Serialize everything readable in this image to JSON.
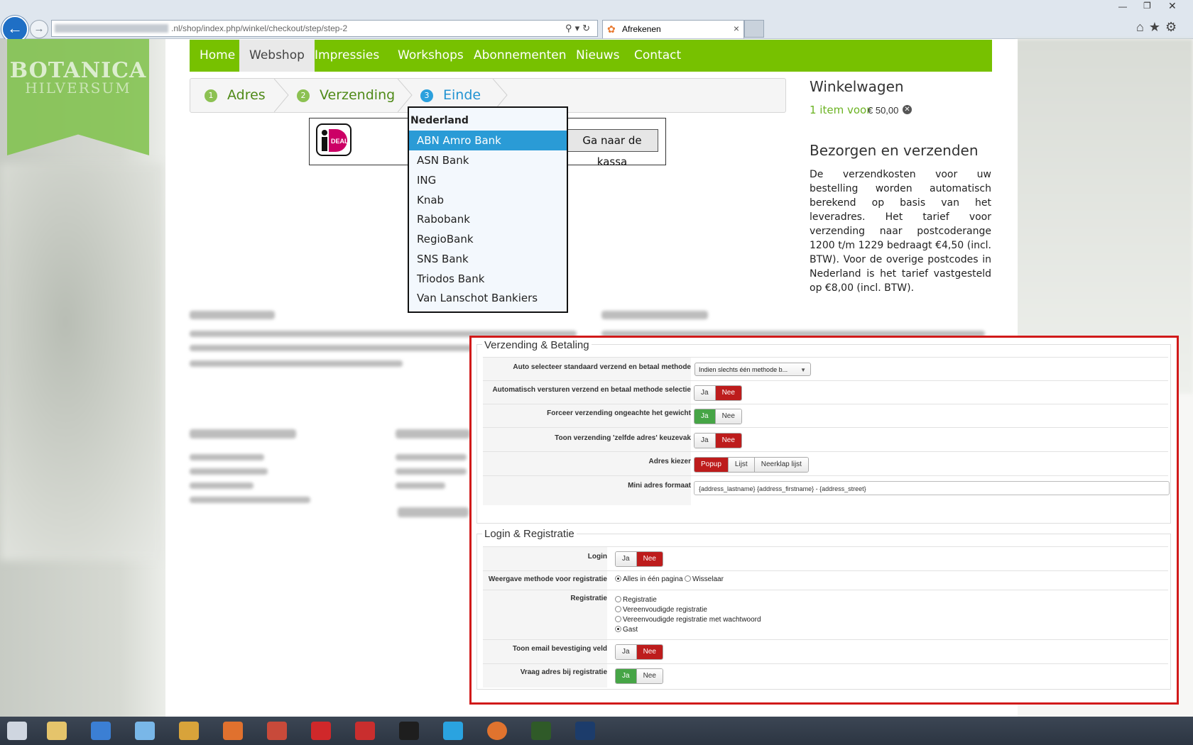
{
  "browser": {
    "url_suffix": ".nl/shop/index.php/winkel/checkout/step/step-2",
    "tab_title": "Afrekenen",
    "tab_close": "×"
  },
  "site": {
    "logo_title": "BOTANICA",
    "logo_subtitle": "HILVERSUM",
    "nav": [
      "Home",
      "Webshop",
      "Impressies",
      "Workshops",
      "Abonnementen",
      "Nieuws",
      "Contact"
    ],
    "nav_active": "Webshop"
  },
  "checkout_steps": [
    {
      "number": "1",
      "label": "Adres"
    },
    {
      "number": "2",
      "label": "Verzending"
    },
    {
      "number": "3",
      "label": "Einde"
    }
  ],
  "payment": {
    "ideal_logo_text": "DEAL",
    "bank_group": "Nederland",
    "banks": [
      "ABN Amro Bank",
      "ASN Bank",
      "ING",
      "Knab",
      "Rabobank",
      "RegioBank",
      "SNS Bank",
      "Triodos Bank",
      "Van Lanschot Bankiers"
    ],
    "selected_bank": "ABN Amro Bank",
    "checkout_button": "Ga naar de kassa"
  },
  "sidebar": {
    "cart_title": "Winkelwagen",
    "cart_items": "1 item voor",
    "cart_price": "€ 50,00",
    "shipping_title": "Bezorgen en verzenden",
    "shipping_text": "De verzendkosten voor uw bestelling worden automatisch berekend op basis van het leveradres. Het tarief voor verzending naar postcoderange 1200 t/m 1229 bedraagt €4,50 (incl. BTW). Voor de overige postcodes in Nederland is het tarief vastgesteld op €8,00 (incl. BTW)."
  },
  "admin": {
    "section1_title": "Verzending & Betaling",
    "rows1": [
      {
        "label": "Auto selecteer standaard verzend en betaal methode",
        "select": "Indien slechts één methode b..."
      },
      {
        "label": "Automatisch versturen verzend en betaal methode selectie",
        "on": "Ja",
        "off": "Nee",
        "value": "Nee"
      },
      {
        "label": "Forceer verzending ongeachte het gewicht",
        "on": "Ja",
        "off": "Nee",
        "value": "Ja"
      },
      {
        "label": "Toon verzending 'zelfde adres' keuzevak",
        "on": "Ja",
        "off": "Nee",
        "value": "Nee"
      },
      {
        "label": "Adres kiezer",
        "options": [
          "Popup",
          "Lijst",
          "Neerklap lijst"
        ],
        "value": "Popup"
      },
      {
        "label": "Mini adres formaat",
        "input": "{address_lastname} {address_firstname} - {address_street}"
      }
    ],
    "section2_title": "Login & Registratie",
    "rows2": [
      {
        "label": "Login",
        "on": "Ja",
        "off": "Nee",
        "value": "Nee"
      },
      {
        "label": "Weergave methode voor registratie",
        "options": [
          "Alles in één pagina",
          "Wisselaar"
        ],
        "value": "Alles in één pagina"
      },
      {
        "label": "Registratie",
        "options": [
          "Registratie",
          "Vereenvoudigde registratie",
          "Vereenvoudigde registratie met wachtwoord",
          "Gast"
        ],
        "value": "Gast"
      },
      {
        "label": "Toon email bevestiging veld",
        "on": "Ja",
        "off": "Nee",
        "value": "Nee"
      },
      {
        "label": "Vraag adres bij registratie",
        "on": "Ja",
        "off": "Nee",
        "value": "Ja"
      }
    ]
  },
  "colors": {
    "nav_green": "#77c100",
    "highlight_blue": "#2a9bd6",
    "frame_red": "#d11a1a",
    "toggle_red": "#bd1c1c",
    "toggle_green": "#46a546"
  }
}
